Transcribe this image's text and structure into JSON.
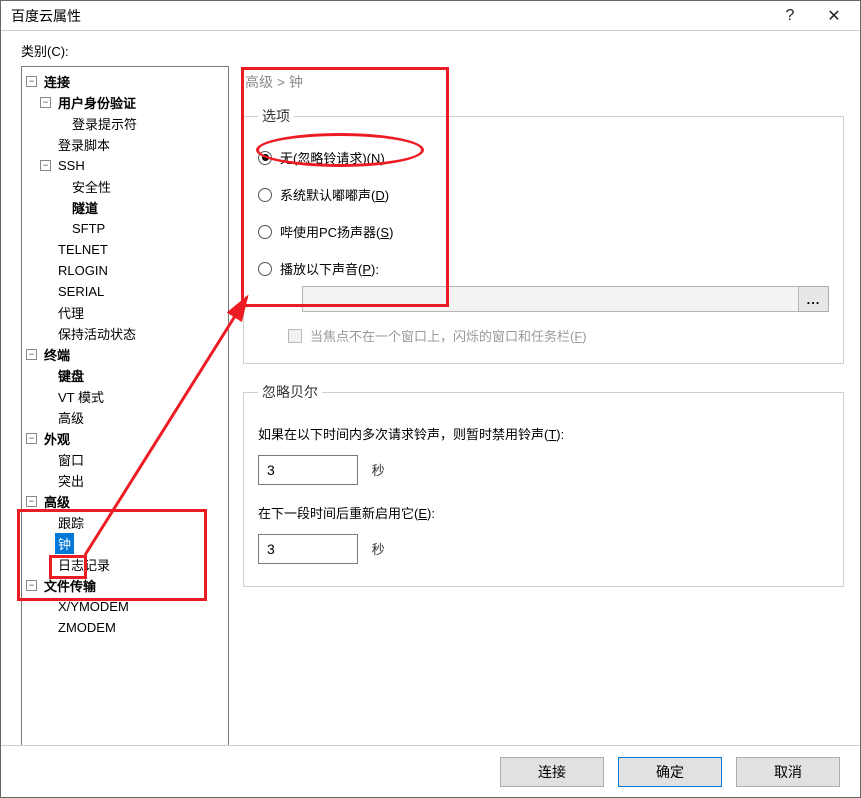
{
  "window": {
    "title": "百度云属性"
  },
  "category_label": "类别(C):",
  "tree": {
    "connection": {
      "label": "连接"
    },
    "auth": {
      "label": "用户身份验证"
    },
    "login_prompt": {
      "label": "登录提示符"
    },
    "login_script": {
      "label": "登录脚本"
    },
    "ssh": {
      "label": "SSH"
    },
    "security": {
      "label": "安全性"
    },
    "tunnel": {
      "label": "隧道"
    },
    "sftp": {
      "label": "SFTP"
    },
    "telnet": {
      "label": "TELNET"
    },
    "rlogin": {
      "label": "RLOGIN"
    },
    "serial": {
      "label": "SERIAL"
    },
    "proxy": {
      "label": "代理"
    },
    "keepalive": {
      "label": "保持活动状态"
    },
    "terminal": {
      "label": "终端"
    },
    "keyboard": {
      "label": "键盘"
    },
    "vtmode": {
      "label": "VT 模式"
    },
    "term_adv": {
      "label": "高级"
    },
    "appearance": {
      "label": "外观"
    },
    "window": {
      "label": "窗口"
    },
    "highlight": {
      "label": "突出"
    },
    "advanced": {
      "label": "高级"
    },
    "trace": {
      "label": "跟踪"
    },
    "bell": {
      "label": "钟"
    },
    "logging": {
      "label": "日志记录"
    },
    "filetrans": {
      "label": "文件传输"
    },
    "xymodem": {
      "label": "X/YMODEM"
    },
    "zmodem": {
      "label": "ZMODEM"
    }
  },
  "breadcrumb": "高级  >  钟",
  "options": {
    "legend": "选项",
    "none_pre": "无(忽略铃请求)(",
    "none_key": "N",
    "none_post": ")",
    "beep_pre": "系统默认嘟嘟声(",
    "beep_key": "D",
    "beep_post": ")",
    "speaker_pre": "哔使用PC扬声器(",
    "speaker_key": "S",
    "speaker_post": ")",
    "play_pre": "播放以下声音(",
    "play_key": "P",
    "play_post": "):",
    "sound_path": "",
    "browse": "...",
    "flash_pre": "当焦点不在一个窗口上，闪烁的窗口和任务栏(",
    "flash_key": "F",
    "flash_post": ")"
  },
  "ignore": {
    "legend": "忽略贝尔",
    "line1_pre": "如果在以下时间内多次请求铃声，则暂时禁用铃声(",
    "line1_key": "T",
    "line1_post": "):",
    "val1": "3",
    "sec": "秒",
    "line2_pre": "在下一段时间后重新启用它(",
    "line2_key": "E",
    "line2_post": "):",
    "val2": "3"
  },
  "buttons": {
    "connect": "连接",
    "ok": "确定",
    "cancel": "取消"
  },
  "glyph": {
    "minus": "−",
    "help": "?",
    "close": "✕"
  }
}
